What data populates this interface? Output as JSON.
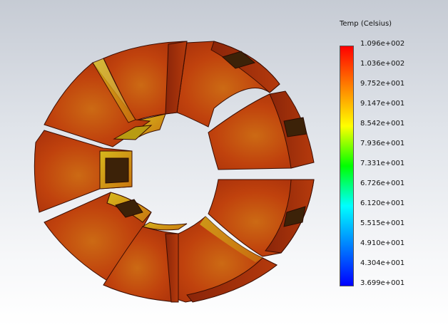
{
  "legend": {
    "title": "Temp (Celsius)",
    "labels": [
      "1.096e+002",
      "1.036e+002",
      "9.752e+001",
      "9.147e+001",
      "8.542e+001",
      "7.936e+001",
      "7.331e+001",
      "6.726e+001",
      "6.120e+001",
      "5.515e+001",
      "4.910e+001",
      "4.304e+001",
      "3.699e+001"
    ],
    "colors": [
      "#ff0000",
      "#ff4000",
      "#ff8000",
      "#ffbf00",
      "#ffff00",
      "#80ff00",
      "#00ff00",
      "#00ff80",
      "#00ffff",
      "#00bfff",
      "#0080ff",
      "#0040ff",
      "#0000ff"
    ]
  },
  "model": {
    "segment_count": 8,
    "base_color": "#a22d0c",
    "face_color": "#c2400d",
    "highlight_color": "#d8a61a"
  }
}
